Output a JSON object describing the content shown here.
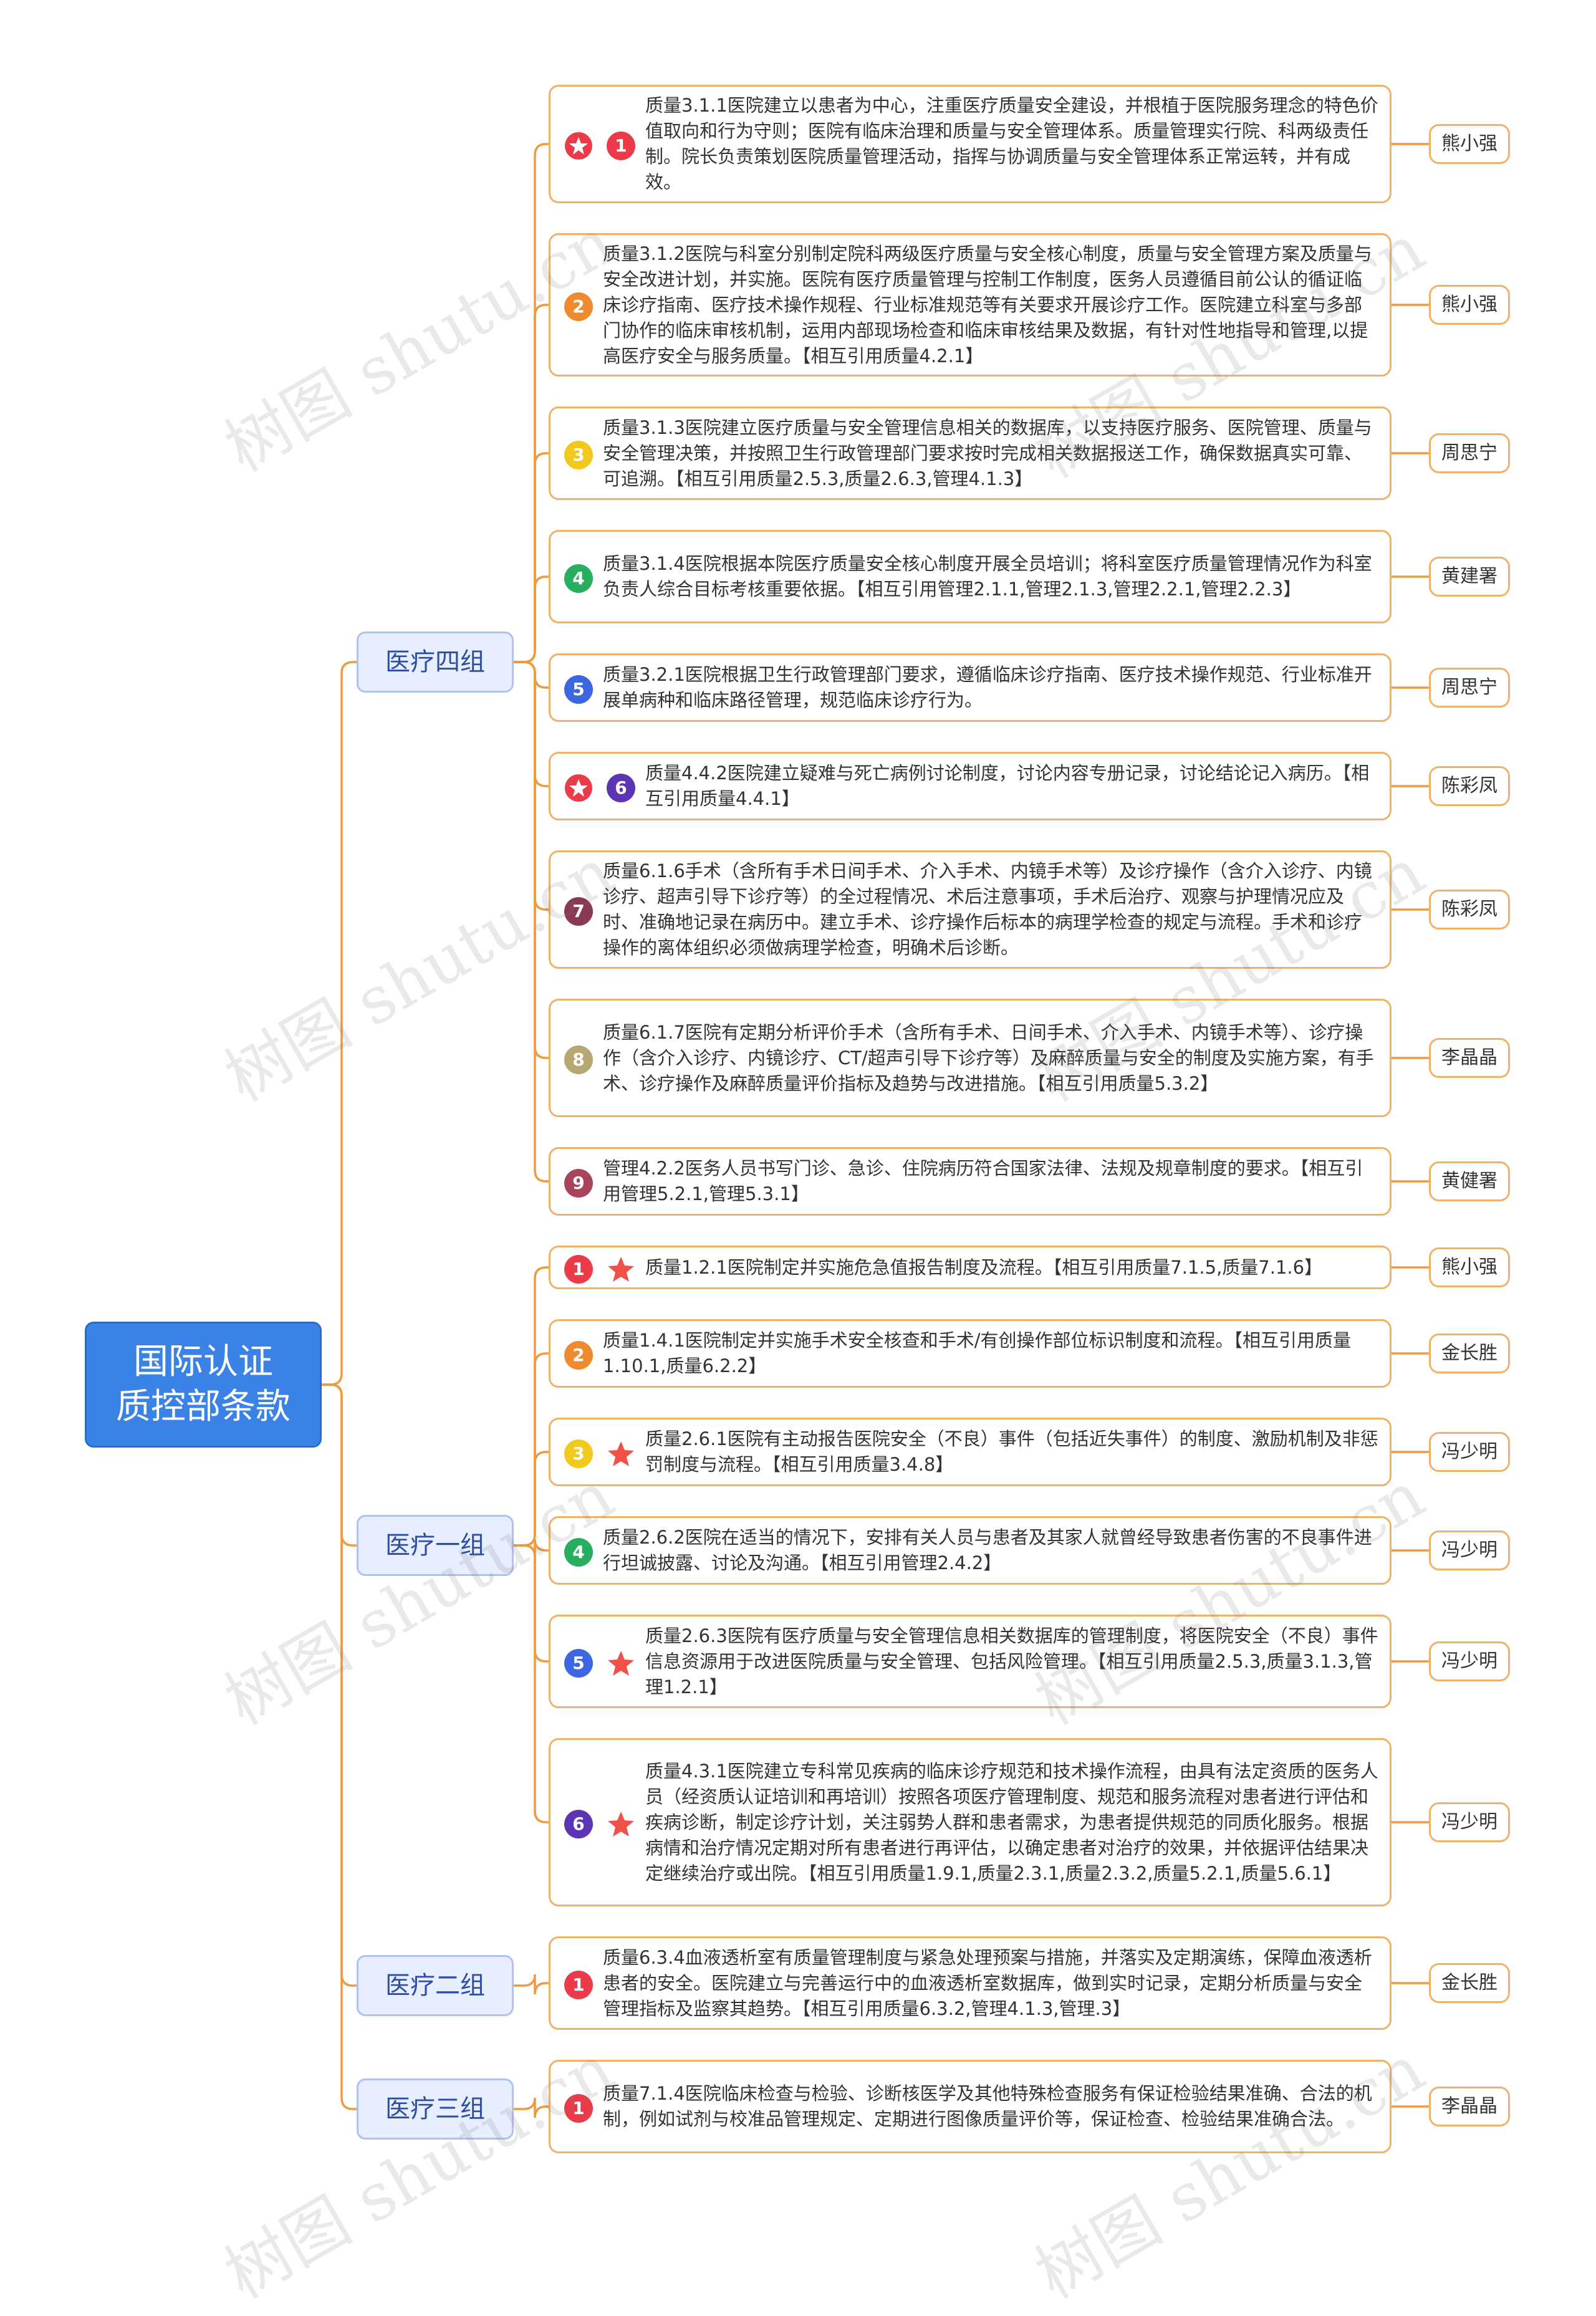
{
  "title_lines": [
    "国际认证",
    "质控部条款"
  ],
  "watermark": "树图 shutu.cn",
  "colors": {
    "root_bg": "#3b82e6",
    "group_bg": "#e7eeff",
    "line": "#ef9a3c",
    "card_border": "#f2b168",
    "star": "#f0524a"
  },
  "groups": [
    {
      "label": "医疗四组",
      "items": [
        {
          "num": "1",
          "color": "#ec3b48",
          "star": "circle",
          "text": "质量3.1.1医院建立以患者为中心，注重医疗质量安全建设，并根植于医院服务理念的特色价值取向和行为守则；医院有临床治理和质量与安全管理体系。质量管理实行院、科两级责任制。院长负责策划医院质量管理活动，指挥与协调质量与安全管理体系正常运转，并有成效。",
          "person": "熊小强"
        },
        {
          "num": "2",
          "color": "#f08a2e",
          "star": "",
          "text": "质量3.1.2医院与科室分别制定院科两级医疗质量与安全核心制度，质量与安全管理方案及质量与安全改进计划，并实施。医院有医疗质量管理与控制工作制度，医务人员遵循目前公认的循证临床诊疗指南、医疗技术操作规程、行业标准规范等有关要求开展诊疗工作。医院建立科室与多部门协作的临床审核机制，运用内部现场检查和临床审核结果及数据，有针对性地指导和管理,以提高医疗安全与服务质量。【相互引用质量4.2.1】",
          "person": "熊小强"
        },
        {
          "num": "3",
          "color": "#f2c81c",
          "star": "",
          "text": "质量3.1.3医院建立医疗质量与安全管理信息相关的数据库，以支持医疗服务、医院管理、质量与安全管理决策，并按照卫生行政管理部门要求按时完成相关数据报送工作，确保数据真实可靠、可追溯。【相互引用质量2.5.3,质量2.6.3,管理4.1.3】",
          "person": "周思宁"
        },
        {
          "num": "4",
          "color": "#27ae60",
          "star": "",
          "text": "质量3.1.4医院根据本院医疗质量安全核心制度开展全员培训；将科室医疗质量管理情况作为科室负责人综合目标考核重要依据。【相互引用管理2.1.1,管理2.1.3,管理2.2.1,管理2.2.3】",
          "person": "黄建署"
        },
        {
          "num": "5",
          "color": "#3c67e0",
          "star": "",
          "text": "质量3.2.1医院根据卫生行政管理部门要求，遵循临床诊疗指南、医疗技术操作规范、行业标准开展单病种和临床路径管理，规范临床诊疗行为。",
          "person": "周思宁"
        },
        {
          "num": "6",
          "color": "#5b35b3",
          "star": "circle",
          "text": "质量4.4.2医院建立疑难与死亡病例讨论制度，讨论内容专册记录，讨论结论记入病历。【相互引用质量4.4.1】",
          "person": "陈彩凤"
        },
        {
          "num": "7",
          "color": "#8a3a52",
          "star": "",
          "text": "质量6.1.6手术（含所有手术日间手术、介入手术、内镜手术等）及诊疗操作（含介入诊疗、内镜诊疗、超声引导下诊疗等）的全过程情况、术后注意事项，手术后治疗、观察与护理情况应及时、准确地记录在病历中。建立手术、诊疗操作后标本的病理学检查的规定与流程。手术和诊疗操作的离体组织必须做病理学检查，明确术后诊断。",
          "person": "陈彩凤"
        },
        {
          "num": "8",
          "color": "#b5a672",
          "star": "",
          "text": "质量6.1.7医院有定期分析评价手术（含所有手术、日间手术、介入手术、内镜手术等）、诊疗操作（含介入诊疗、内镜诊疗、CT/超声引导下诊疗等）及麻醉质量与安全的制度及实施方案，有手术、诊疗操作及麻醉质量评价指标及趋势与改进措施。【相互引用质量5.3.2】",
          "person": "李晶晶"
        },
        {
          "num": "9",
          "color": "#a8455c",
          "star": "",
          "text": "管理4.2.2医务人员书写门诊、急诊、住院病历符合国家法律、法规及规章制度的要求。【相互引用管理5.2.1,管理5.3.1】",
          "person": "黄健署"
        }
      ]
    },
    {
      "label": "医疗一组",
      "items": [
        {
          "num": "1",
          "color": "#ec3b48",
          "star": "star",
          "text": "质量1.2.1医院制定并实施危急值报告制度及流程。【相互引用质量7.1.5,质量7.1.6】",
          "person": "熊小强"
        },
        {
          "num": "2",
          "color": "#f08a2e",
          "star": "",
          "text": "质量1.4.1医院制定并实施手术安全核查和手术/有创操作部位标识制度和流程。【相互引用质量1.10.1,质量6.2.2】",
          "person": "金长胜"
        },
        {
          "num": "3",
          "color": "#f2c81c",
          "star": "star",
          "text": "质量2.6.1医院有主动报告医院安全（不良）事件（包括近失事件）的制度、激励机制及非惩罚制度与流程。【相互引用质量3.4.8】",
          "person": "冯少明"
        },
        {
          "num": "4",
          "color": "#27ae60",
          "star": "",
          "text": "质量2.6.2医院在适当的情况下，安排有关人员与患者及其家人就曾经导致患者伤害的不良事件进行坦诚披露、讨论及沟通。【相互引用管理2.4.2】",
          "person": "冯少明"
        },
        {
          "num": "5",
          "color": "#3c67e0",
          "star": "star",
          "text": "质量2.6.3医院有医疗质量与安全管理信息相关数据库的管理制度，将医院安全（不良）事件信息资源用于改进医院质量与安全管理、包括风险管理。【相互引用质量2.5.3,质量3.1.3,管理1.2.1】",
          "person": "冯少明"
        },
        {
          "num": "6",
          "color": "#5b35b3",
          "star": "star",
          "text": "质量4.3.1医院建立专科常见疾病的临床诊疗规范和技术操作流程，由具有法定资质的医务人员（经资质认证培训和再培训）按照各项医疗管理制度、规范和服务流程对患者进行评估和疾病诊断，制定诊疗计划，关注弱势人群和患者需求，为患者提供规范的同质化服务。根据病情和治疗情况定期对所有患者进行再评估，以确定患者对治疗的效果，并依据评估结果决定继续治疗或出院。【相互引用质量1.9.1,质量2.3.1,质量2.3.2,质量5.2.1,质量5.6.1】",
          "person": "冯少明"
        }
      ]
    },
    {
      "label": "医疗二组",
      "items": [
        {
          "num": "1",
          "color": "#ec3b48",
          "star": "",
          "text": "质量6.3.4血液透析室有质量管理制度与紧急处理预案与措施，并落实及定期演练，保障血液透析患者的安全。医院建立与完善运行中的血液透析室数据库，做到实时记录，定期分析质量与安全管理指标及监察其趋势。【相互引用质量6.3.2,管理4.1.3,管理.3】",
          "person": "金长胜"
        }
      ]
    },
    {
      "label": "医疗三组",
      "items": [
        {
          "num": "1",
          "color": "#ec3b48",
          "star": "",
          "text": "质量7.1.4医院临床检查与检验、诊断核医学及其他特殊检查服务有保证检验结果准确、合法的机制，例如试剂与校准品管理规定、定期进行图像质量评价等，保证检查、检验结果准确合法。",
          "person": "李晶晶"
        }
      ]
    }
  ]
}
